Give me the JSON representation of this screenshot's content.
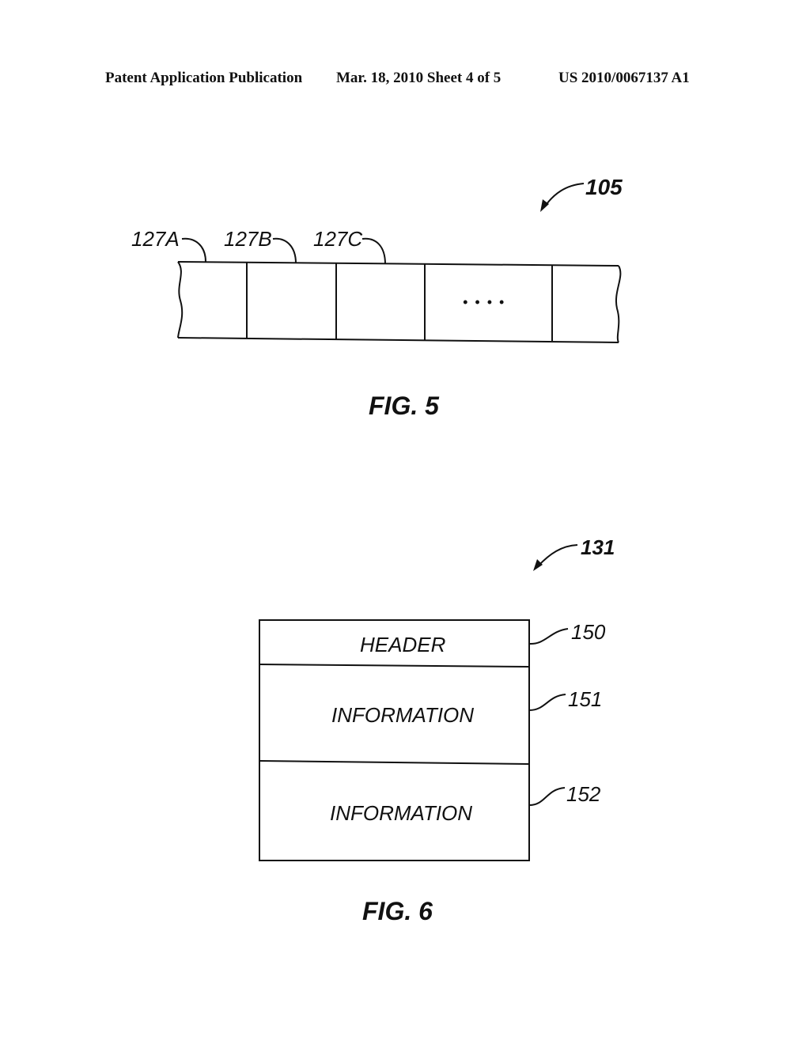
{
  "header": {
    "publication": "Patent Application Publication",
    "date_sheet": "Mar. 18, 2010  Sheet 4 of 5",
    "number": "US 2010/0067137 A1"
  },
  "fig5": {
    "ref": "105",
    "cell_labels": [
      "127A",
      "127B",
      "127C"
    ],
    "ellipsis": "• • • •",
    "caption": "FIG. 5"
  },
  "fig6": {
    "ref": "131",
    "rows": [
      {
        "text": "HEADER",
        "ref": "150"
      },
      {
        "text": "INFORMATION",
        "ref": "151"
      },
      {
        "text": "INFORMATION",
        "ref": "152"
      }
    ],
    "caption": "FIG. 6"
  }
}
